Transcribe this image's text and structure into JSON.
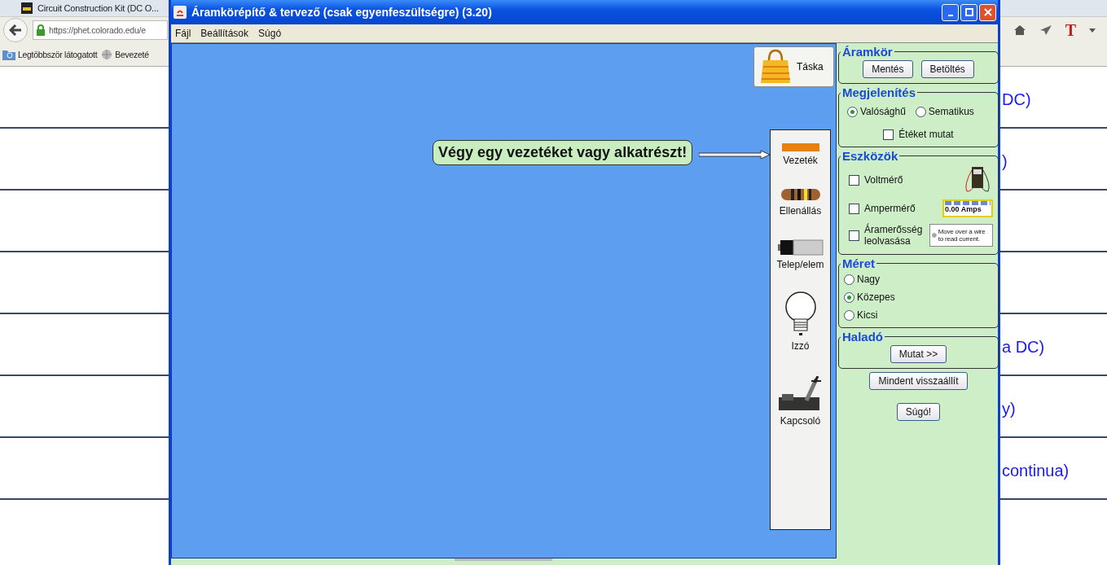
{
  "browser": {
    "tab_title": "Circuit Construction Kit (DC O...",
    "url": "https://phet.colorado.edu/e",
    "bookmarks": [
      {
        "kind": "folder",
        "label": "Legtöbbször látogatott"
      },
      {
        "kind": "globe",
        "label": "Bevezeté"
      }
    ],
    "toolbar_glyph": "T",
    "page_rows": [
      {
        "text": "DC)"
      },
      {
        "text": ")"
      },
      {},
      {},
      {
        "text": "a DC)"
      },
      {
        "text": "y)"
      },
      {
        "text": "continua)"
      }
    ]
  },
  "window": {
    "title": "Áramkörépítő & tervező (csak egyenfeszültségre) (3.20)",
    "menu": [
      "Fájl",
      "Beállítások",
      "Súgó"
    ],
    "canvas": {
      "bag_button": "Táska",
      "hint": "Végy egy vezetéket vagy alkatrészt!",
      "toolbox": [
        {
          "kind": "wire",
          "label": "Vezeték"
        },
        {
          "kind": "resistor",
          "label": "Ellenállás"
        },
        {
          "kind": "battery",
          "label": "Telep/elem"
        },
        {
          "kind": "bulb",
          "label": "Izzó"
        },
        {
          "kind": "switch",
          "label": "Kapcsoló"
        }
      ]
    },
    "panel": {
      "sections": [
        {
          "title": "Áramkör",
          "controls": [
            {
              "kind": "button_row",
              "buttons": [
                "Mentés",
                "Betöltés"
              ]
            }
          ]
        },
        {
          "title": "Megjelenítés",
          "controls": [
            {
              "kind": "radio_row",
              "options": [
                {
                  "label": "Valósághű",
                  "selected": true
                },
                {
                  "label": "Sematikus",
                  "selected": false
                }
              ]
            },
            {
              "kind": "checkbox",
              "label": "Étéket mutat",
              "checked": false
            }
          ]
        },
        {
          "title": "Eszközök",
          "controls": [
            {
              "kind": "voltmeter",
              "label": "Voltmérő",
              "checked": false
            },
            {
              "kind": "ammeter",
              "label": "Ampermérő",
              "checked": false,
              "readout": "0.00 Amps"
            },
            {
              "kind": "probe",
              "label": "Áramerősség leolvasása",
              "checked": false,
              "readout": "Move over a wire to read current."
            }
          ]
        },
        {
          "title": "Méret",
          "controls": [
            {
              "kind": "radio_list",
              "options": [
                {
                  "label": "Nagy",
                  "selected": false
                },
                {
                  "label": "Közepes",
                  "selected": true
                },
                {
                  "label": "Kicsi",
                  "selected": false
                }
              ]
            }
          ]
        },
        {
          "title": "Haladó",
          "controls": [
            {
              "kind": "button_row",
              "buttons": [
                "Mutat >>"
              ]
            }
          ]
        }
      ],
      "buttons": [
        "Mindent visszaállít",
        "Súgó!"
      ]
    }
  }
}
